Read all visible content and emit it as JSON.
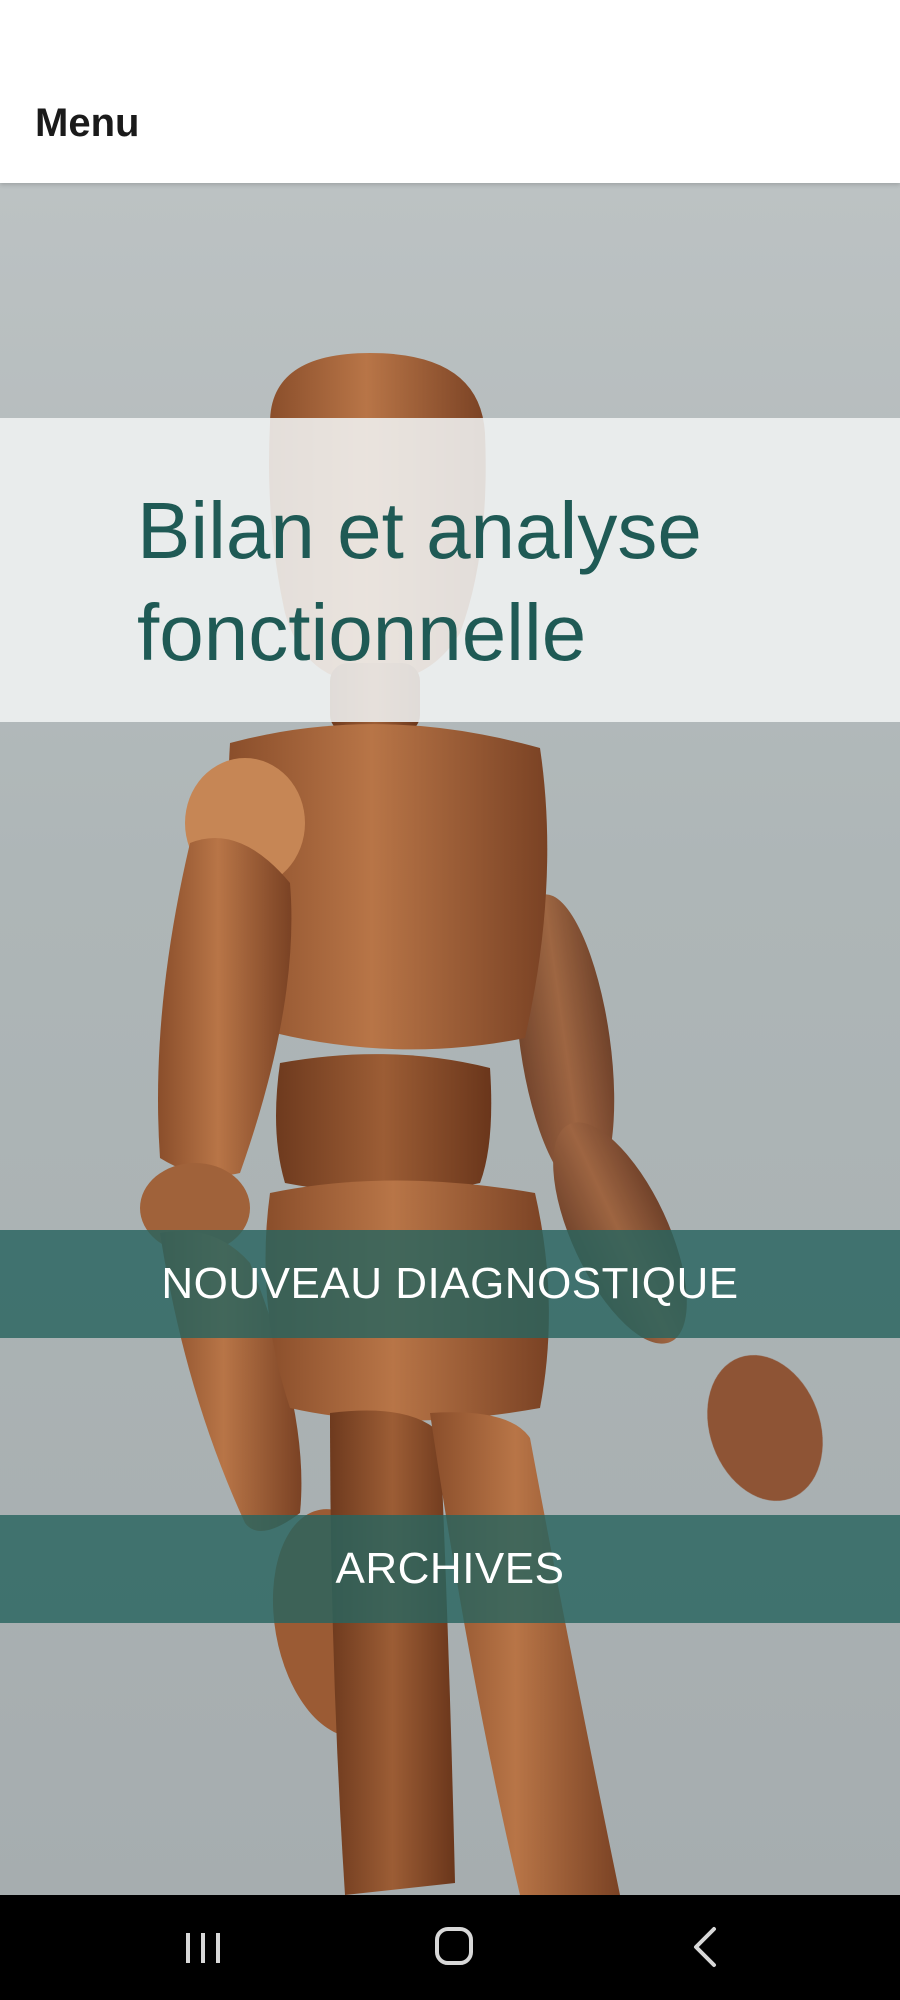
{
  "app_bar": {
    "title": "Menu"
  },
  "hero": {
    "title": "Bilan et analyse\nfonctionnelle",
    "image_subject": "wooden-mannequin"
  },
  "actions": {
    "new_diagnostic_label": "NOUVEAU DIAGNOSTIQUE",
    "archives_label": "ARCHIVES"
  },
  "colors": {
    "accent": "#1f5a55",
    "button_bg": "#28645f",
    "app_bar_bg": "#ffffff",
    "nav_bar_bg": "#000000"
  },
  "system_nav": {
    "recents_icon": "recents-icon",
    "home_icon": "home-icon",
    "back_icon": "back-icon"
  }
}
